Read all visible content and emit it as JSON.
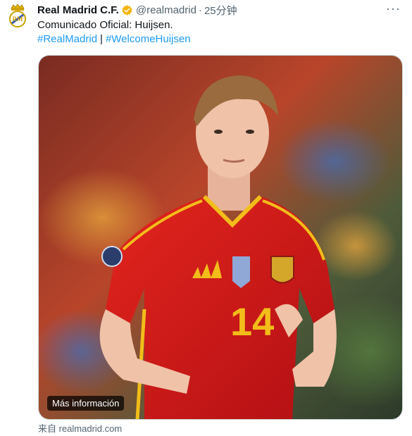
{
  "tweet": {
    "author_name": "Real Madrid C.F.",
    "handle": "@realmadrid",
    "separator": "·",
    "time": "25分钟",
    "more_glyph": "···",
    "text": "Comunicado Oficial: Huijsen.",
    "hashtags": [
      "#RealMadrid",
      "#WelcomeHuijsen"
    ],
    "hashtag_separator": "|"
  },
  "card": {
    "overlay_label": "Más información",
    "jersey_number": "14",
    "source_label": "来自 realmadrid.com"
  },
  "colors": {
    "link": "#1d9bf0",
    "verified": "#f4b400",
    "jersey_red": "#d3151c",
    "jersey_yellow": "#f2bd1a"
  },
  "icons": {
    "avatar": "real-madrid-crest-icon",
    "verified": "verified-badge-icon",
    "more": "more-icon"
  }
}
